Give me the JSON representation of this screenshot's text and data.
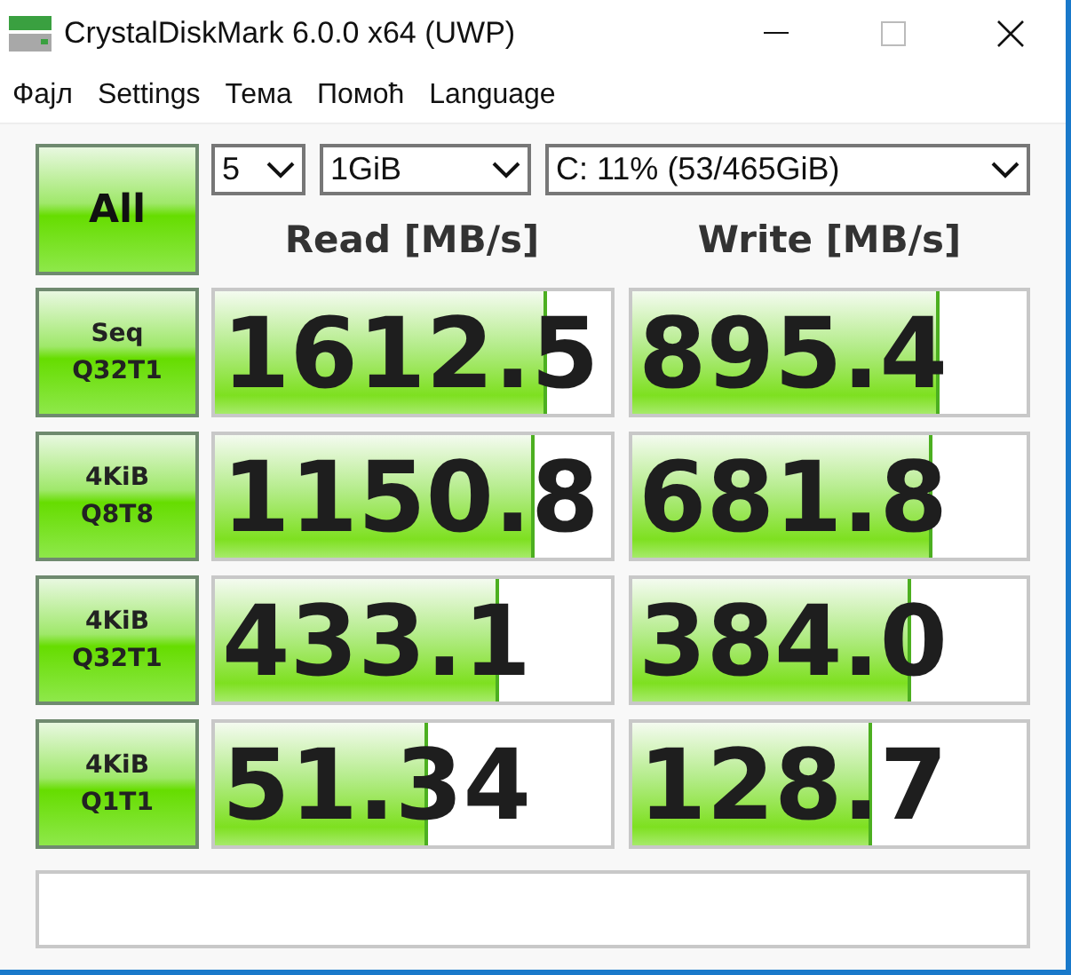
{
  "window": {
    "title": "CrystalDiskMark 6.0.0 x64 (UWP)"
  },
  "menu": [
    "Фајл",
    "Settings",
    "Тема",
    "Помоћ",
    "Language"
  ],
  "all_button": "All",
  "selects": [
    {
      "value": "5"
    },
    {
      "value": "1GiB"
    },
    {
      "value": "C: 11% (53/465GiB)"
    }
  ],
  "columns": [
    "Read [MB/s]",
    "Write [MB/s]"
  ],
  "rows": [
    {
      "label": "Seq\nQ32T1",
      "read": {
        "value": "1612.5",
        "level": 0.84
      },
      "write": {
        "value": "895.4",
        "level": 0.78
      }
    },
    {
      "label": "4KiB\nQ8T8",
      "read": {
        "value": "1150.8",
        "level": 0.81
      },
      "write": {
        "value": "681.8",
        "level": 0.76
      }
    },
    {
      "label": "4KiB\nQ32T1",
      "read": {
        "value": "433.1",
        "level": 0.72
      },
      "write": {
        "value": "384.0",
        "level": 0.71
      }
    },
    {
      "label": "4KiB\nQ1T1",
      "read": {
        "value": "51.34",
        "level": 0.54
      },
      "write": {
        "value": "128.7",
        "level": 0.61
      }
    }
  ]
}
